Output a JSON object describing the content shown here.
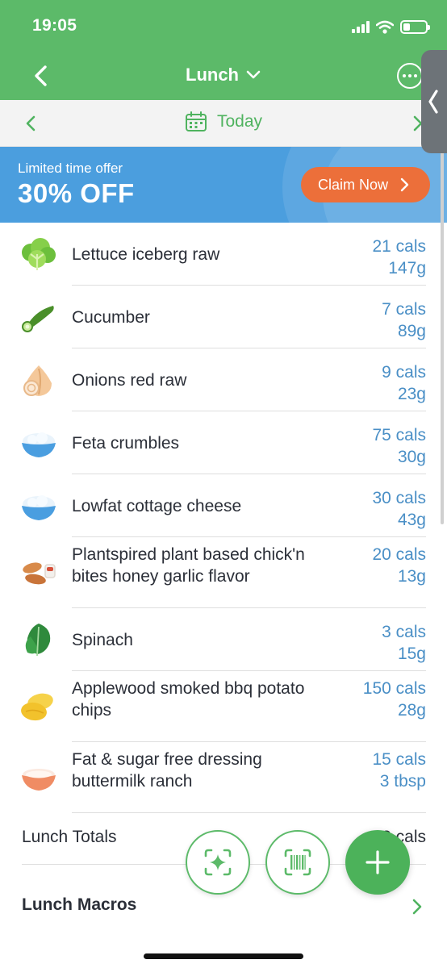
{
  "status": {
    "time": "19:05"
  },
  "nav": {
    "title": "Lunch"
  },
  "date": {
    "label": "Today"
  },
  "promo": {
    "subtitle": "Limited time offer",
    "headline": "30% OFF",
    "button_label": "Claim Now"
  },
  "foods": [
    {
      "name": "Lettuce iceberg raw",
      "cals": "21 cals",
      "amount": "147g",
      "icon": "lettuce-icon"
    },
    {
      "name": "Cucumber",
      "cals": "7 cals",
      "amount": "89g",
      "icon": "cucumber-icon"
    },
    {
      "name": "Onions red raw",
      "cals": "9 cals",
      "amount": "23g",
      "icon": "onion-icon"
    },
    {
      "name": "Feta crumbles",
      "cals": "75 cals",
      "amount": "30g",
      "icon": "bowl-icon"
    },
    {
      "name": "Lowfat cottage cheese",
      "cals": "30 cals",
      "amount": "43g",
      "icon": "bowl-icon"
    },
    {
      "name": "Plantspired plant based chick'n bites honey garlic flavor",
      "cals": "20 cals",
      "amount": "13g",
      "icon": "nuggets-icon"
    },
    {
      "name": "Spinach",
      "cals": "3 cals",
      "amount": "15g",
      "icon": "spinach-icon"
    },
    {
      "name": "Applewood smoked bbq potato chips",
      "cals": "150 cals",
      "amount": "28g",
      "icon": "chips-icon"
    },
    {
      "name": "Fat & sugar free dressing buttermilk ranch",
      "cals": "15 cals",
      "amount": "3 tbsp",
      "icon": "dressing-bowl-icon"
    }
  ],
  "totals": {
    "label": "Lunch Totals",
    "value": "3 cals"
  },
  "macros": {
    "label": "Lunch Macros"
  },
  "colors": {
    "brand_green": "#5cba69",
    "link_blue": "#4a8fc6",
    "promo_blue": "#4b9ede",
    "claim_orange": "#ec6f3a"
  }
}
